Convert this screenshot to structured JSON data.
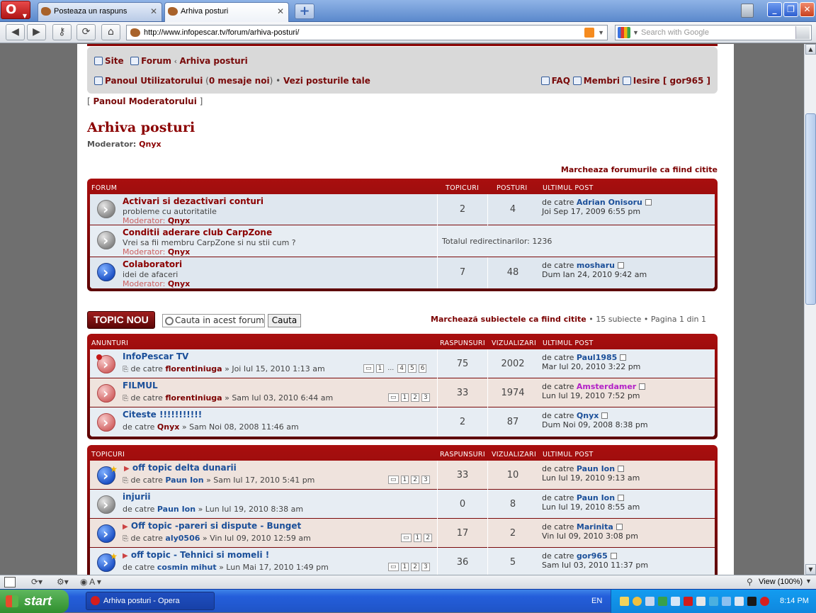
{
  "browser": {
    "tabs": [
      {
        "label": "Posteaza un raspuns"
      },
      {
        "label": "Arhiva posturi"
      }
    ],
    "url": "http://www.infopescar.tv/forum/arhiva-posturi/",
    "search_placeholder": "Search with Google",
    "status_zoom": "View (100%)"
  },
  "forumnav": {
    "crumbs": [
      "Site",
      "Forum",
      "Arhiva posturi"
    ],
    "ucp": "Panoul Utilizatorului",
    "ucp_paren_open": "(",
    "ucp_msgs": "0 mesaje noi",
    "ucp_paren_close": ")",
    "bullet": "•",
    "own_posts": "Vezi posturile tale",
    "faq": "FAQ",
    "members": "Membri",
    "logout": "Iesire [ gor965 ]",
    "mcp": "Panoul Moderatorului"
  },
  "page": {
    "title": "Arhiva posturi",
    "moderator_label": "Moderator:",
    "moderator_name": "Qnyx",
    "mark_forums": "Marcheaza forumurile ca fiind citite"
  },
  "forums_table": {
    "headers": {
      "forum": "FORUM",
      "topics": "TOPICURI",
      "posts": "POSTURI",
      "last": "ULTIMUL POST"
    },
    "rows": [
      {
        "title": "Activari si dezactivari conturi",
        "desc": "probleme cu autoritatile",
        "mod_label": "Moderator:",
        "mod": "Qnyx",
        "topics": "2",
        "posts": "4",
        "by": "de catre",
        "last_user": "Adrian Onisoru",
        "last_date": "Joi Sep 17, 2009 6:55 pm"
      },
      {
        "title": "Conditii aderare club CarpZone",
        "desc": "Vrei sa fii membru CarpZone si nu stii cum ?",
        "mod_label": "Moderator:",
        "mod": "Qnyx",
        "redirects": "Totalul redirectinarilor: 1236"
      },
      {
        "title": "Colaboratori",
        "desc": "idei de afaceri",
        "mod_label": "Moderator:",
        "mod": "Qnyx",
        "topics": "7",
        "posts": "48",
        "by": "de catre",
        "last_user": "mosharu",
        "last_date": "Dum Ian 24, 2010 9:42 am"
      }
    ]
  },
  "toolbar": {
    "new_topic": "TOPIC NOU",
    "search_value": "Cauta in acest forum...",
    "search_btn": "Cauta",
    "mark_topics": "Marchează subiectele ca fiind citite",
    "summary": "• 15 subiecte • Pagina 1 din 1"
  },
  "announcements": {
    "headers": {
      "title": "ANUNTURI",
      "replies": "RASPUNSURI",
      "views": "VIZUALIZARI",
      "last": "ULTIMUL POST"
    },
    "rows": [
      {
        "title": "InfoPescar TV",
        "by": "de catre",
        "author": "florentiniuga",
        "date": "» Joi Iul 15, 2010 1:13 am",
        "pages": [
          "1",
          "…",
          "4",
          "5",
          "6"
        ],
        "replies": "75",
        "views": "2002",
        "last_by": "de catre",
        "last_user": "Paul1985",
        "last_date": "Mar Iul 20, 2010 3:22 pm"
      },
      {
        "title": "FILMUL",
        "by": "de catre",
        "author": "florentiniuga",
        "date": "» Sam Iul 03, 2010 6:44 am",
        "pages": [
          "1",
          "2",
          "3"
        ],
        "replies": "33",
        "views": "1974",
        "last_by": "de catre",
        "last_user": "Amsterdamer",
        "last_date": "Lun Iul 19, 2010 7:52 pm"
      },
      {
        "title": "Citeste !!!!!!!!!!!",
        "by": "de catre",
        "author": "Qnyx",
        "date": "» Sam Noi 08, 2008 11:46 am",
        "pages": [],
        "replies": "2",
        "views": "87",
        "last_by": "de catre",
        "last_user": "Qnyx",
        "last_date": "Dum Noi 09, 2008 8:38 pm"
      }
    ]
  },
  "topics": {
    "headers": {
      "title": "TOPICURI",
      "replies": "RASPUNSURI",
      "views": "VIZUALIZARI",
      "last": "ULTIMUL POST"
    },
    "rows": [
      {
        "title": "off topic delta dunarii",
        "by": "de catre",
        "author": "Paun Ion",
        "date": "» Sam Iul 17, 2010 5:41 pm",
        "pages": [
          "1",
          "2",
          "3"
        ],
        "replies": "33",
        "views": "10",
        "last_by": "de catre",
        "last_user": "Paun Ion",
        "last_date": "Lun Iul 19, 2010 9:13 am"
      },
      {
        "title": "injurii",
        "by": "de catre",
        "author": "Paun Ion",
        "date": "» Lun Iul 19, 2010 8:38 am",
        "pages": [],
        "replies": "0",
        "views": "8",
        "last_by": "de catre",
        "last_user": "Paun Ion",
        "last_date": "Lun Iul 19, 2010 8:55 am"
      },
      {
        "title": "Off topic -pareri si dispute - Bunget",
        "by": "de catre",
        "author": "aly0506",
        "date": "» Vin Iul 09, 2010 12:59 am",
        "pages": [
          "1",
          "2"
        ],
        "replies": "17",
        "views": "2",
        "last_by": "de catre",
        "last_user": "Marinita",
        "last_date": "Vin Iul 09, 2010 3:08 pm"
      },
      {
        "title": "off topic - Tehnici si momeli !",
        "by": "de catre",
        "author": "cosmin mihut",
        "date": "» Lun Mai 17, 2010 1:49 pm",
        "pages": [
          "1",
          "2",
          "3"
        ],
        "replies": "36",
        "views": "5",
        "last_by": "de catre",
        "last_user": "gor965",
        "last_date": "Sam Iul 03, 2010 11:37 pm"
      }
    ]
  },
  "taskbar": {
    "start": "start",
    "item": "Arhiva posturi - Opera",
    "lang": "EN",
    "clock": "8:14 PM"
  }
}
